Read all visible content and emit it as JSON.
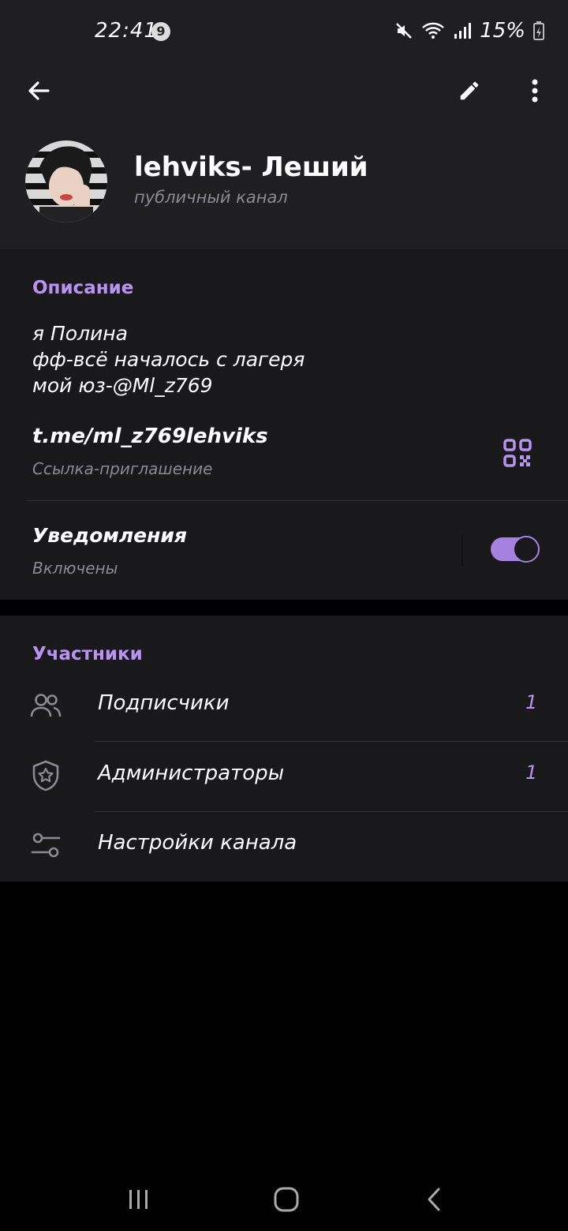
{
  "status_bar": {
    "time": "22:41",
    "notification_count": "9",
    "battery": "15%"
  },
  "header": {
    "title": "lehviks- Леший",
    "subtitle": "публичный канал"
  },
  "info": {
    "section_title": "Описание",
    "description_lines": [
      "я Полина",
      "фф-всё началось с лагеря",
      "мой юз-@Ml_z769"
    ],
    "link": "t.me/ml_z769lehviks",
    "link_label": "Ссылка-приглашение",
    "notifications_label": "Уведомления",
    "notifications_state": "Включены",
    "notifications_enabled": true
  },
  "members": {
    "section_title": "Участники",
    "items": [
      {
        "label": "Подписчики",
        "count": "1",
        "icon": "people-icon"
      },
      {
        "label": "Администраторы",
        "count": "1",
        "icon": "shield-star-icon"
      },
      {
        "label": "Настройки канала",
        "count": "",
        "icon": "sliders-icon"
      }
    ]
  },
  "colors": {
    "accent": "#b894f0",
    "header_bg": "#1f1e21",
    "card_bg": "#19191c",
    "background": "#000000"
  }
}
